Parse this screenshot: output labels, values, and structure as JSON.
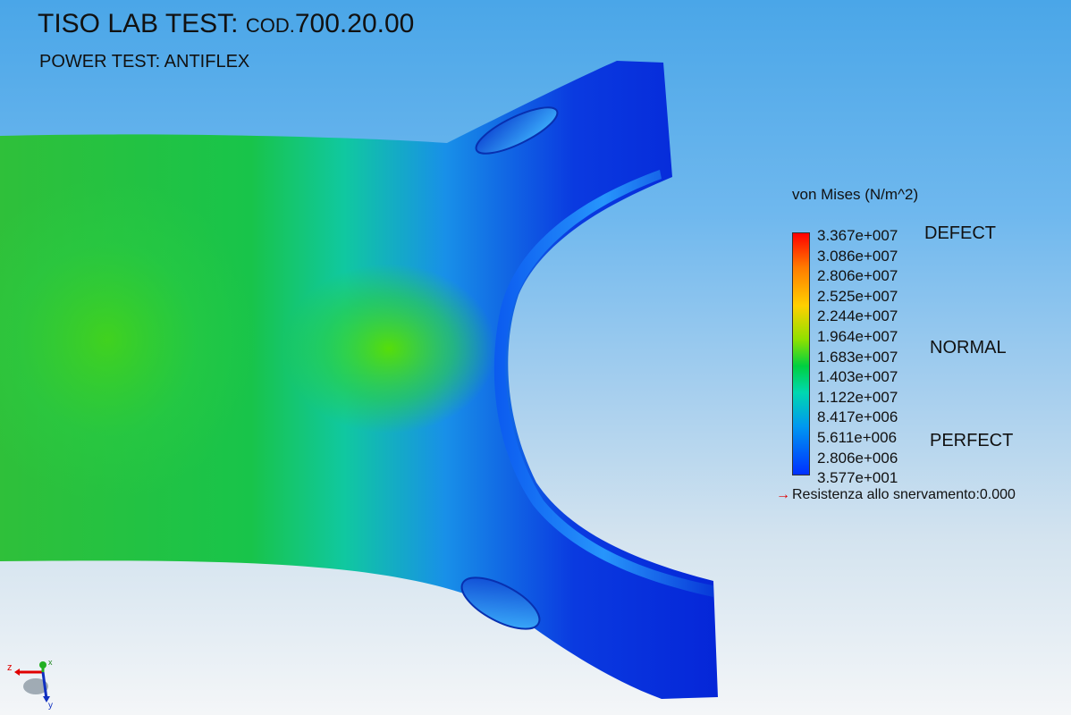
{
  "header": {
    "title_main": "TISO LAB TEST:",
    "title_code_prefix": "COD.",
    "title_code_value": "700.20.00",
    "subtitle_label": "POWER TEST",
    "subtitle_colon": ":",
    "subtitle_value": "ANTIFLEX"
  },
  "legend": {
    "title": "von Mises (N/m^2)",
    "ticks": [
      "3.367e+007",
      "3.086e+007",
      "2.806e+007",
      "2.525e+007",
      "2.244e+007",
      "1.964e+007",
      "1.683e+007",
      "1.403e+007",
      "1.122e+007",
      "8.417e+006",
      "5.611e+006",
      "2.806e+006",
      "3.577e+001"
    ],
    "levels": {
      "defect": "DEFECT",
      "normal": "NORMAL",
      "perfect": "PERFECT"
    },
    "yield_label": "Resistenza allo snervamento:0.000"
  },
  "triad": {
    "z_label": "z",
    "x_label": "x",
    "y_label": "y"
  },
  "colors": {
    "max": "#ff0000",
    "mid": "#00d040",
    "min": "#0030ff",
    "arrow": "#e00000"
  }
}
